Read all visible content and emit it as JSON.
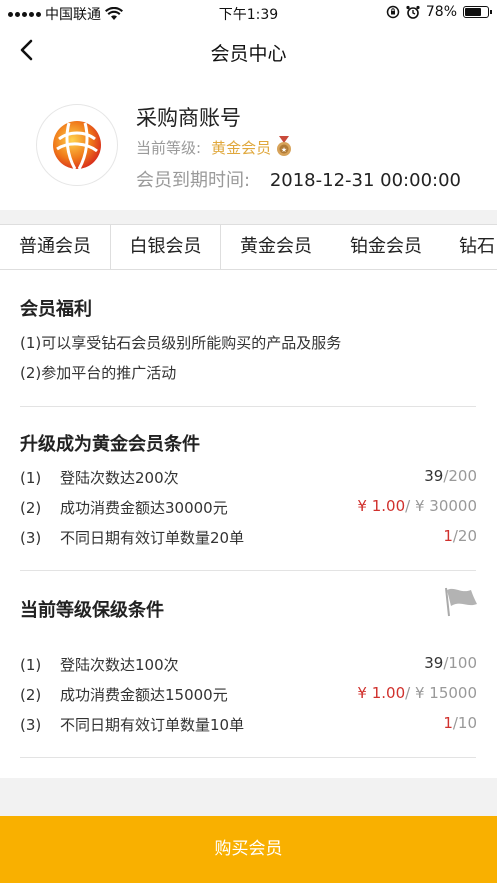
{
  "status_bar": {
    "carrier": "中国联通",
    "time": "下午1:39",
    "battery": "78%",
    "battery_level": 0.78
  },
  "nav": {
    "title": "会员中心",
    "back_icon": "chevron-left-icon"
  },
  "profile": {
    "account_name": "采购商账号",
    "level_label": "当前等级:",
    "level_value": "黄金会员",
    "expire_label": "会员到期时间:",
    "expire_value": "2018-12-31 00:00:00"
  },
  "tabs": [
    {
      "label": "普通会员",
      "active": false
    },
    {
      "label": "白银会员",
      "active": true
    },
    {
      "label": "黄金会员",
      "active": false
    },
    {
      "label": "铂金会员",
      "active": false
    },
    {
      "label": "钻石",
      "active": false
    }
  ],
  "benefits": {
    "title": "会员福利",
    "items": [
      "(1)可以享受钻石会员级别所能购买的产品及服务",
      "(2)参加平台的推广活动"
    ]
  },
  "upgrade": {
    "title": "升级成为黄金会员条件",
    "conditions": [
      {
        "num": "(1)",
        "text": "登陆次数达200次",
        "current": "39",
        "target": "/200"
      },
      {
        "num": "(2)",
        "text": "成功消费金额达30000元",
        "current": "¥ 1.00",
        "target": "/ ¥ 30000"
      },
      {
        "num": "(3)",
        "text": "不同日期有效订单数量20单",
        "current": "1",
        "target": "/20"
      }
    ]
  },
  "keep": {
    "title": "当前等级保级条件",
    "conditions": [
      {
        "num": "(1)",
        "text": "登陆次数达100次",
        "current": "39",
        "target": "/100"
      },
      {
        "num": "(2)",
        "text": "成功消费金额达15000元",
        "current": "¥ 1.00",
        "target": "/ ¥ 15000"
      },
      {
        "num": "(3)",
        "text": "不同日期有效订单数量10单",
        "current": "1",
        "target": "/10"
      }
    ]
  },
  "buy_button": "购买会员",
  "colors": {
    "accent": "#f9b000",
    "gold_text": "#e0a83d",
    "red": "#d0312d",
    "grey": "#999999"
  }
}
